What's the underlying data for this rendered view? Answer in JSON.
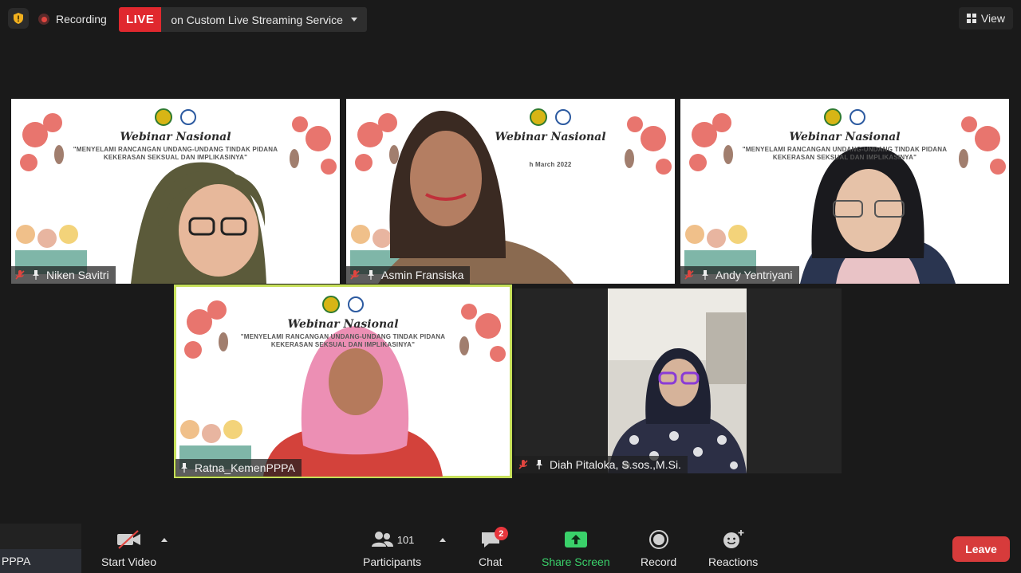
{
  "topbar": {
    "recording_label": "Recording",
    "live_badge": "LIVE",
    "live_text": "on Custom Live Streaming Service",
    "view_label": "View"
  },
  "banner": {
    "title": "Webinar Nasional",
    "subtitle_line1": "\"MENYELAMI RANCANGAN UNDANG-UNDANG TINDAK PIDANA",
    "subtitle_line2": "KEKERASAN SEKSUAL DAN IMPLIKASINYA\"",
    "date_fragment": "h March 2022"
  },
  "participants": [
    {
      "name": "Niken Savitri",
      "muted": true,
      "pinned": true
    },
    {
      "name": "Asmin Fransiska",
      "muted": true,
      "pinned": true
    },
    {
      "name": "Andy Yentriyani",
      "muted": true,
      "pinned": true
    },
    {
      "name": "Ratna_KemenPPPA",
      "muted": false,
      "pinned": true,
      "active_speaker": true
    },
    {
      "name": "Diah Pitaloka, S.sos.,M.Si.",
      "muted": true,
      "pinned": true
    }
  ],
  "toolbar": {
    "left_caption": "PPPA",
    "start_video": "Start Video",
    "participants_label": "Participants",
    "participants_count": "101",
    "chat_label": "Chat",
    "chat_badge": "2",
    "share_label": "Share Screen",
    "record_label": "Record",
    "reactions_label": "Reactions",
    "leave_label": "Leave"
  },
  "colors": {
    "live_red": "#e0282e",
    "share_green": "#3ad16a",
    "active_border": "#c7e05a",
    "leave_red": "#d73b3b",
    "background": "#1a1a1a"
  },
  "icons": [
    "shield-icon",
    "record-dot-icon",
    "chevron-down-icon",
    "grid-view-icon",
    "mic-muted-icon",
    "pin-icon",
    "video-off-icon",
    "participants-icon",
    "chat-icon",
    "share-screen-icon",
    "record-icon",
    "reactions-icon"
  ]
}
